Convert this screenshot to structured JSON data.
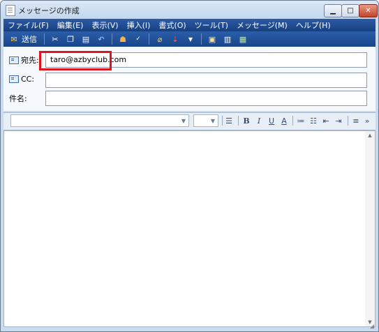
{
  "window": {
    "title": "メッセージの作成"
  },
  "menu": [
    "ファイル(F)",
    "編集(E)",
    "表示(V)",
    "挿入(I)",
    "書式(O)",
    "ツール(T)",
    "メッセージ(M)",
    "ヘルプ(H)"
  ],
  "toolbar": {
    "send_label": "送信",
    "icons": [
      "cut-icon",
      "copy-icon",
      "paste-icon",
      "undo-icon",
      "address-book-icon",
      "spellcheck-icon",
      "attach-icon",
      "priority-icon",
      "dropdown-icon",
      "sign-icon",
      "encrypt-icon",
      "offline-icon"
    ]
  },
  "header": {
    "to_label": "宛先:",
    "to_value": "taro@azbyclub.com",
    "cc_label": "CC:",
    "cc_value": "",
    "subject_label": "件名:",
    "subject_value": ""
  },
  "format_bar": {
    "font_value": "",
    "size_value": "",
    "buttons": [
      "paragraph-style-icon",
      "bold-icon",
      "italic-icon",
      "underline-icon",
      "font-color-icon",
      "numbered-list-icon",
      "bulleted-list-icon",
      "decrease-indent-icon",
      "increase-indent-icon",
      "align-icon",
      "more-icon"
    ],
    "bold": "B",
    "italic": "I",
    "underline": "U",
    "color": "A",
    "more": "»"
  },
  "message_body": {
    "text": ""
  },
  "colors": {
    "highlight": "#e0141e",
    "menubar": "#1f4a8e"
  }
}
